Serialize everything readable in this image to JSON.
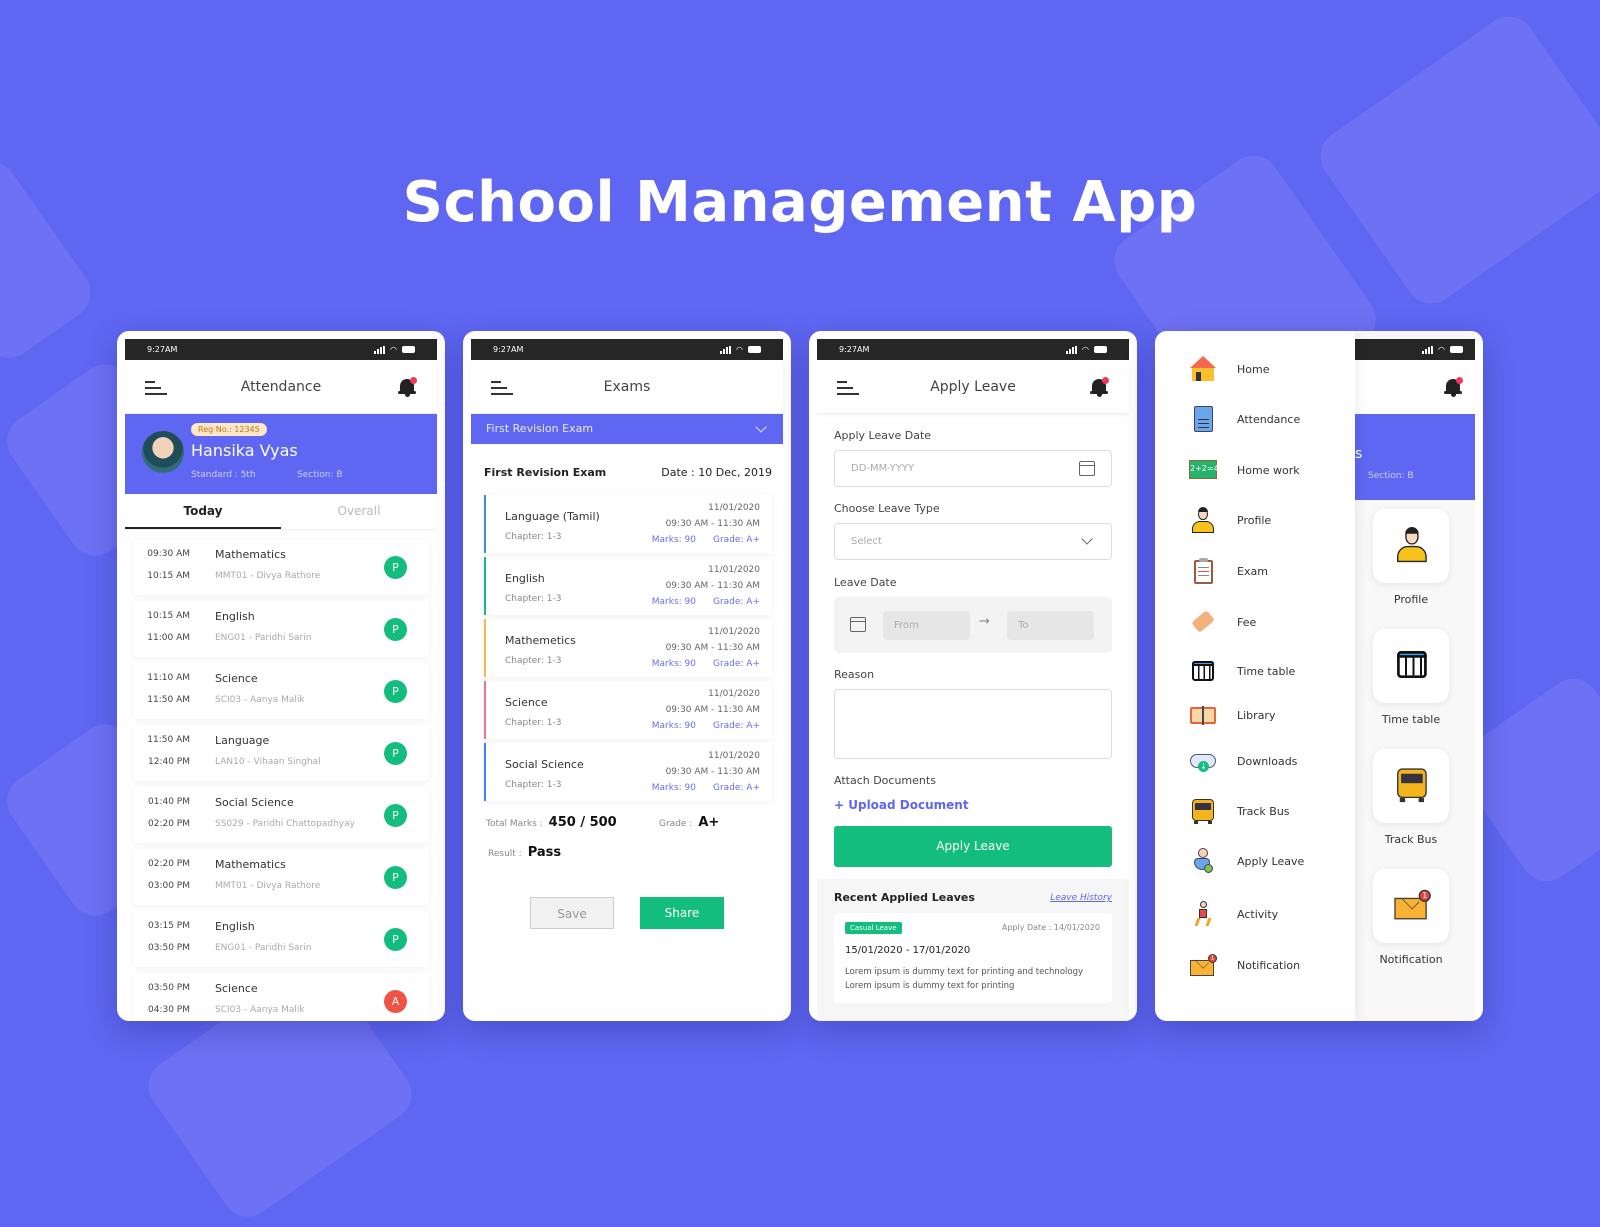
{
  "page_title": "School Management App",
  "status_bar": {
    "time": "9:27AM"
  },
  "attendance_screen": {
    "title": "Attendance",
    "student": {
      "reg_no": "Reg No.: 12345",
      "name": "Hansika Vyas",
      "standard": "Standard : 5th",
      "section": "Section: B"
    },
    "tabs": [
      {
        "label": "Today",
        "active": true
      },
      {
        "label": "Overall",
        "active": false
      }
    ],
    "rows": [
      {
        "start": "09:30 AM",
        "end": "10:15 AM",
        "subject": "Mathematics",
        "teacher": "MMT01 - Divya Rathore",
        "status": "P"
      },
      {
        "start": "10:15 AM",
        "end": "11:00 AM",
        "subject": "English",
        "teacher": "ENG01 - Paridhi Sarin",
        "status": "P"
      },
      {
        "start": "11:10 AM",
        "end": "11:50 AM",
        "subject": "Science",
        "teacher": "SCI03 - Aanya Malik",
        "status": "P"
      },
      {
        "start": "11:50 AM",
        "end": "12:40 PM",
        "subject": "Language",
        "teacher": "LAN10 - Vihaan Singhal",
        "status": "P"
      },
      {
        "start": "01:40 PM",
        "end": "02:20 PM",
        "subject": "Social Science",
        "teacher": "SS029 - Paridhi Chattopadhyay",
        "status": "P"
      },
      {
        "start": "02:20 PM",
        "end": "03:00 PM",
        "subject": "Mathematics",
        "teacher": "MMT01 - Divya Rathore",
        "status": "P"
      },
      {
        "start": "03:15 PM",
        "end": "03:50 PM",
        "subject": "English",
        "teacher": "ENG01 - Paridhi Sarin",
        "status": "P"
      },
      {
        "start": "03:50 PM",
        "end": "04:30 PM",
        "subject": "Science",
        "teacher": "SCI03 - Aanya Malik",
        "status": "A"
      }
    ],
    "status_colors": {
      "P": "#13bd7e",
      "A": "#ee5345"
    }
  },
  "exams_screen": {
    "title": "Exams",
    "selected_exam": "First Revision Exam",
    "exam_name": "First Revision Exam",
    "exam_date": "Date : 10 Dec, 2019",
    "rows": [
      {
        "subject": "Language (Tamil)",
        "chapter": "Chapter: 1-3",
        "date": "11/01/2020",
        "time": "09:30 AM - 11:30 AM",
        "marks": "Marks: 90",
        "grade": "Grade: A+",
        "color": "#3f8fd6"
      },
      {
        "subject": "English",
        "chapter": "Chapter: 1-3",
        "date": "11/01/2020",
        "time": "09:30 AM - 11:30 AM",
        "marks": "Marks: 90",
        "grade": "Grade: A+",
        "color": "#13bd7e"
      },
      {
        "subject": "Mathemetics",
        "chapter": "Chapter: 1-3",
        "date": "11/01/2020",
        "time": "09:30 AM - 11:30 AM",
        "marks": "Marks: 90",
        "grade": "Grade: A+",
        "color": "#f2b851"
      },
      {
        "subject": "Science",
        "chapter": "Chapter: 1-3",
        "date": "11/01/2020",
        "time": "09:30 AM - 11:30 AM",
        "marks": "Marks: 90",
        "grade": "Grade: A+",
        "color": "#f0718a"
      },
      {
        "subject": "Social Science",
        "chapter": "Chapter: 1-3",
        "date": "11/01/2020",
        "time": "09:30 AM - 11:30 AM",
        "marks": "Marks: 90",
        "grade": "Grade: A+",
        "color": "#3f7ff0"
      }
    ],
    "total_marks_label": "Total Marks :",
    "total_marks": "450 / 500",
    "grade_label": "Grade :",
    "grade": "A+",
    "result_label": "Result :",
    "result": "Pass",
    "save_label": "Save",
    "share_label": "Share"
  },
  "leave_screen": {
    "title": "Apply Leave",
    "apply_date_label": "Apply Leave Date",
    "apply_date_placeholder": "DD-MM-YYYY",
    "leave_type_label": "Choose Leave Type",
    "leave_type_value": "Select",
    "leave_date_label": "Leave Date",
    "from_placeholder": "From",
    "to_placeholder": "To",
    "reason_label": "Reason",
    "reason_value": "",
    "attach_label": "Attach Documents",
    "upload_label": "+ Upload Document",
    "apply_button": "Apply Leave",
    "recent_title": "Recent Applied Leaves",
    "history_link": "Leave History",
    "recent": {
      "type": "Casual Leave",
      "apply_date": "Apply Date : 14/01/2020",
      "range": "15/01/2020 - 17/01/2020",
      "description": "Lorem ipsum is dummy text for printing and technology Lorem ipsum is dummy text for printing"
    }
  },
  "menu_screen": {
    "items": [
      {
        "label": "Home",
        "icon": "home-icon"
      },
      {
        "label": "Attendance",
        "icon": "attendance-icon"
      },
      {
        "label": "Home work",
        "icon": "blackboard-icon"
      },
      {
        "label": "Profile",
        "icon": "profile-icon"
      },
      {
        "label": "Exam",
        "icon": "clipboard-icon"
      },
      {
        "label": "Fee",
        "icon": "price-tag-icon"
      },
      {
        "label": "Time table",
        "icon": "calendar-grid-icon"
      },
      {
        "label": "Library",
        "icon": "book-icon"
      },
      {
        "label": "Downloads",
        "icon": "cloud-download-icon"
      },
      {
        "label": "Track Bus",
        "icon": "bus-icon"
      },
      {
        "label": "Apply Leave",
        "icon": "leave-user-icon"
      },
      {
        "label": "Activity",
        "icon": "running-icon"
      },
      {
        "label": "Notification",
        "icon": "mail-notification-icon"
      }
    ],
    "background_section": "Section: B",
    "background_name_fragment": "s",
    "tiles": [
      {
        "label": "Profile",
        "icon": "profile-icon"
      },
      {
        "label": "Time table",
        "icon": "calendar-grid-icon"
      },
      {
        "label": "Track Bus",
        "icon": "bus-icon"
      },
      {
        "label": "Notification",
        "icon": "mail-notification-icon"
      }
    ],
    "notification_count": "1"
  },
  "colors": {
    "primary": "#5f66f1",
    "success": "#13bd7e",
    "danger": "#ee5345"
  }
}
